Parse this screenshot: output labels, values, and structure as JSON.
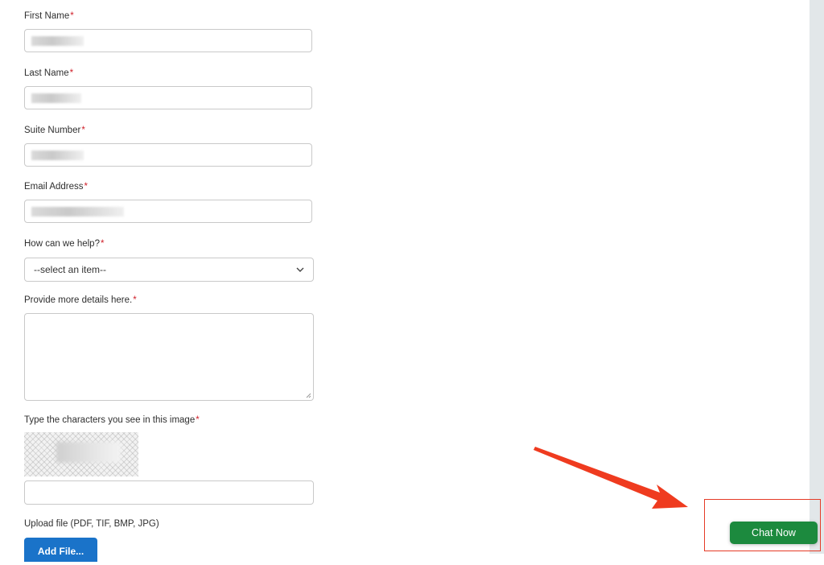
{
  "form": {
    "required_marker": "*",
    "first_name": {
      "label": "First Name",
      "value": ""
    },
    "last_name": {
      "label": "Last Name",
      "value": ""
    },
    "suite_number": {
      "label": "Suite Number",
      "value": ""
    },
    "email": {
      "label": "Email Address",
      "value": ""
    },
    "help_topic": {
      "label": "How can we help?",
      "selected": "--select an item--"
    },
    "details": {
      "label": "Provide more details here.",
      "value": ""
    },
    "captcha": {
      "label": "Type the characters you see in this image",
      "value": ""
    },
    "upload": {
      "label": "Upload file (PDF, TIF, BMP, JPG)",
      "button_label": "Add File..."
    }
  },
  "chat": {
    "button_label": "Chat Now",
    "color": "#1c8a3e"
  },
  "annotation": {
    "color": "#e53b26",
    "icon": "arrow-pointer-icon"
  }
}
